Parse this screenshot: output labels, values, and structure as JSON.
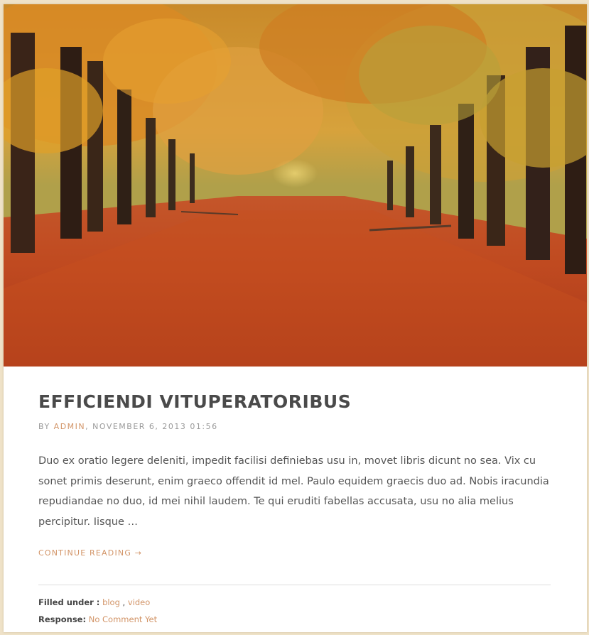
{
  "post": {
    "image_alt": "Autumn forest path",
    "title": "EFFICIENDI VITUPERATORIBUS",
    "meta": {
      "by": "BY",
      "author": "ADMIN",
      "date": ", NOVEMBER 6, 2013 01:56"
    },
    "excerpt": "Duo ex oratio legere deleniti, impedit facilisi definiebas usu in, movet libris dicunt no sea. Vix cu sonet primis deserunt, enim graeco offendit id mel. Paulo equidem graecis duo ad. Nobis iracundia repudiandae no duo, id mei nihil laudem. Te qui eruditi fabellas accusata, usu no alia melius percipitur. Iisque …",
    "continue_label": "CONTINUE READING",
    "continue_arrow": "→"
  },
  "footer": {
    "filed_label": "Filled under :",
    "categories": [
      "blog",
      "video"
    ],
    "category_separator": " , ",
    "response_label": "Response:",
    "response_value": "No Comment Yet"
  },
  "colors": {
    "accent": "#d29467",
    "title": "#4a4a4a",
    "background": "#efe2c8"
  }
}
